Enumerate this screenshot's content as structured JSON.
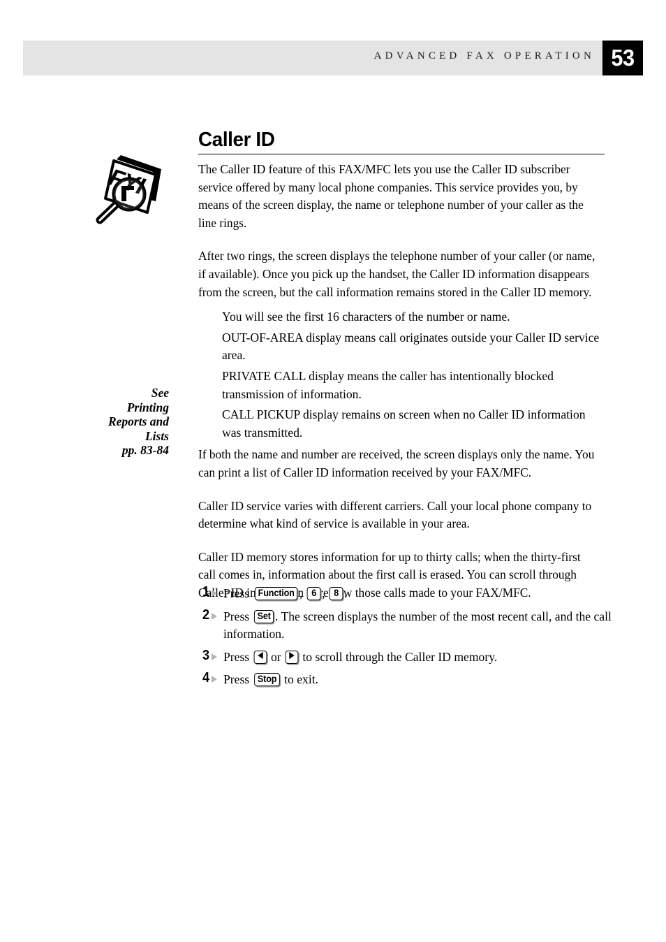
{
  "header": {
    "running_title": "ADVANCED FAX OPERATION",
    "page_number": "53",
    "band_color": "#e4e4e4",
    "badge_color": "#000000"
  },
  "margin_icon": {
    "name": "fyi-icon",
    "label": "FYI"
  },
  "side_note": {
    "line1": "See",
    "line2": "Printing",
    "line3": "Reports and",
    "line4": "Lists",
    "line5": "pp. 83-84"
  },
  "section": {
    "title": "Caller ID",
    "paragraphs": {
      "p1": "The Caller ID feature of this FAX/MFC lets you use the Caller ID subscriber service offered by many local phone companies.   This service provides you, by means of the screen display,  the name or telephone number of your caller as the line rings.",
      "p2": "After two rings, the screen displays the telephone number of your caller (or name, if available).  Once you pick up the  handset, the Caller ID information disappears from the screen, but the call information remains stored in the Caller ID memory.",
      "p3": "If both the name and number are received, the screen displays only the name. You can print a list of Caller ID information received by your FAX/MFC.",
      "p4": "Caller ID service varies with different carriers.  Call your local phone company to determine what kind of service is available in your area.",
      "p5": "Caller ID memory stores information for up to thirty calls; when the thirty-first call comes in, information about the first call is erased.  You can scroll through Caller ID information to review those calls made to your FAX/MFC."
    },
    "indent_items": {
      "i1": "You will see the first 16 characters of the number or name.",
      "i2": "OUT-OF-AREA display means call originates outside your Caller ID service area.",
      "i3": "PRIVATE CALL display means the caller has intentionally blocked transmission of information.",
      "i4": "CALL PICKUP display remains on screen when no Caller ID information was transmitted."
    }
  },
  "steps": [
    {
      "number": "1",
      "press_label": "Press",
      "keys": [
        "Function",
        "6",
        "8"
      ],
      "sep1": ", ",
      "sep2": ", ",
      "tail": "."
    },
    {
      "number": "2",
      "press_label": "Press",
      "key": "Set",
      "tail": ".  The screen displays the number of the most recent call, and the call information."
    },
    {
      "number": "3",
      "press_label": "Press",
      "key_left": "left-arrow",
      "conjunction": " or ",
      "key_right": "right-arrow",
      "tail": " to scroll through the Caller ID memory."
    },
    {
      "number": "4",
      "press_label": "Press",
      "key": "Stop",
      "tail": " to exit."
    }
  ]
}
